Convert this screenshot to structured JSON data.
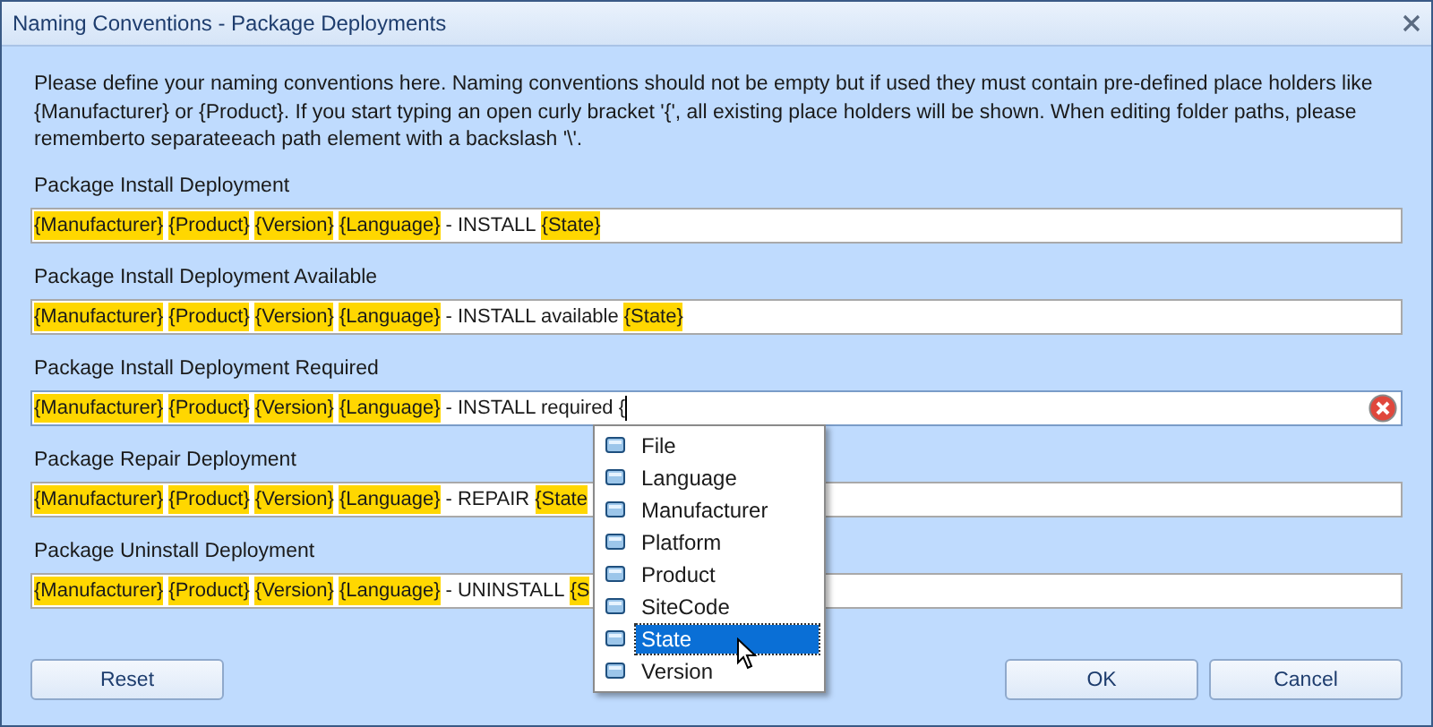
{
  "window": {
    "title": "Naming Conventions - Package Deployments"
  },
  "intro": "Please define your naming conventions here. Naming conventions should not be empty but if used they must contain pre-defined place holders like {Manufacturer} or {Product}. If you start typing an open curly bracket '{', all existing place holders will be shown. When editing folder paths, please rememberto separateeach path element with a backslash '\\'.",
  "fields": [
    {
      "label": "Package Install Deployment",
      "error": false,
      "focused": false,
      "tokens": [
        {
          "kind": "placeholder",
          "text": "{Manufacturer}"
        },
        {
          "kind": "placeholder",
          "text": "{Product}"
        },
        {
          "kind": "placeholder",
          "text": "{Version}"
        },
        {
          "kind": "placeholder",
          "text": "{Language}"
        },
        {
          "kind": "text",
          "text": "- INSTALL"
        },
        {
          "kind": "placeholder",
          "text": "{State}"
        }
      ]
    },
    {
      "label": "Package Install Deployment Available",
      "error": false,
      "focused": false,
      "tokens": [
        {
          "kind": "placeholder",
          "text": "{Manufacturer}"
        },
        {
          "kind": "placeholder",
          "text": "{Product}"
        },
        {
          "kind": "placeholder",
          "text": "{Version}"
        },
        {
          "kind": "placeholder",
          "text": "{Language}"
        },
        {
          "kind": "text",
          "text": "- INSTALL available"
        },
        {
          "kind": "placeholder",
          "text": "{State}"
        }
      ]
    },
    {
      "label": "Package Install Deployment Required",
      "error": true,
      "focused": true,
      "tokens": [
        {
          "kind": "placeholder",
          "text": "{Manufacturer}"
        },
        {
          "kind": "placeholder",
          "text": "{Product}"
        },
        {
          "kind": "placeholder",
          "text": "{Version}"
        },
        {
          "kind": "placeholder",
          "text": "{Language}"
        },
        {
          "kind": "text",
          "text": "- INSTALL required {"
        }
      ]
    },
    {
      "label": "Package Repair Deployment",
      "error": false,
      "focused": false,
      "tokens": [
        {
          "kind": "placeholder",
          "text": "{Manufacturer}"
        },
        {
          "kind": "placeholder",
          "text": "{Product}"
        },
        {
          "kind": "placeholder",
          "text": "{Version}"
        },
        {
          "kind": "placeholder",
          "text": "{Language}"
        },
        {
          "kind": "text",
          "text": "- REPAIR"
        },
        {
          "kind": "placeholder",
          "text": "{State"
        }
      ]
    },
    {
      "label": "Package Uninstall Deployment",
      "error": false,
      "focused": false,
      "tokens": [
        {
          "kind": "placeholder",
          "text": "{Manufacturer}"
        },
        {
          "kind": "placeholder",
          "text": "{Product}"
        },
        {
          "kind": "placeholder",
          "text": "{Version}"
        },
        {
          "kind": "placeholder",
          "text": "{Language}"
        },
        {
          "kind": "text",
          "text": "- UNINSTALL"
        },
        {
          "kind": "placeholder",
          "text": "{S"
        }
      ]
    }
  ],
  "suggestions": [
    {
      "label": "File",
      "selected": false
    },
    {
      "label": "Language",
      "selected": false
    },
    {
      "label": "Manufacturer",
      "selected": false
    },
    {
      "label": "Platform",
      "selected": false
    },
    {
      "label": "Product",
      "selected": false
    },
    {
      "label": "SiteCode",
      "selected": false
    },
    {
      "label": "State",
      "selected": true
    },
    {
      "label": "Version",
      "selected": false
    }
  ],
  "buttons": {
    "left": [
      "Reset"
    ],
    "right": [
      "OK",
      "Cancel"
    ]
  }
}
